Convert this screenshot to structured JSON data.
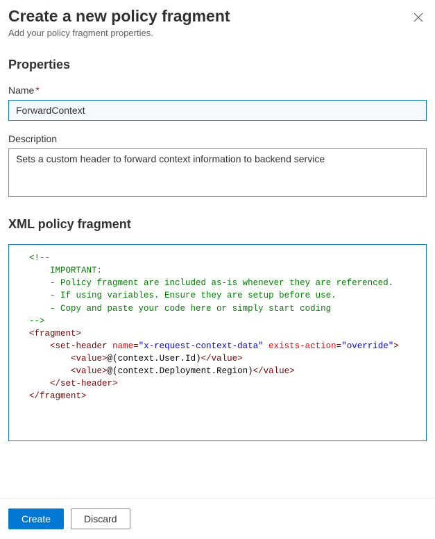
{
  "header": {
    "title": "Create a new policy fragment",
    "subtitle": "Add your policy fragment properties."
  },
  "properties": {
    "heading": "Properties",
    "nameLabel": "Name",
    "nameValue": "ForwardContext",
    "descriptionLabel": "Description",
    "descriptionValue": "Sets a custom header to forward context information to backend service"
  },
  "xmlSection": {
    "heading": "XML policy fragment",
    "code": {
      "commentOpen": "<!--",
      "commentLine1": "    IMPORTANT:",
      "commentLine2": "    - Policy fragment are included as-is whenever they are referenced.",
      "commentLine3": "    - If using variables. Ensure they are setup before use.",
      "commentLine4": "    - Copy and paste your code here or simply start coding",
      "commentClose": "-->",
      "fragmentOpen": "fragment",
      "setHeaderTag": "set-header",
      "setHeaderAttrName1": "name",
      "setHeaderAttrVal1": "\"x-request-context-data\"",
      "setHeaderAttrName2": "exists-action",
      "setHeaderAttrVal2": "\"override\"",
      "valueTag": "value",
      "valueText1": "@(context.User.Id)",
      "valueText2": "@(context.Deployment.Region)",
      "fragmentClose": "fragment"
    }
  },
  "footer": {
    "createLabel": "Create",
    "discardLabel": "Discard"
  }
}
